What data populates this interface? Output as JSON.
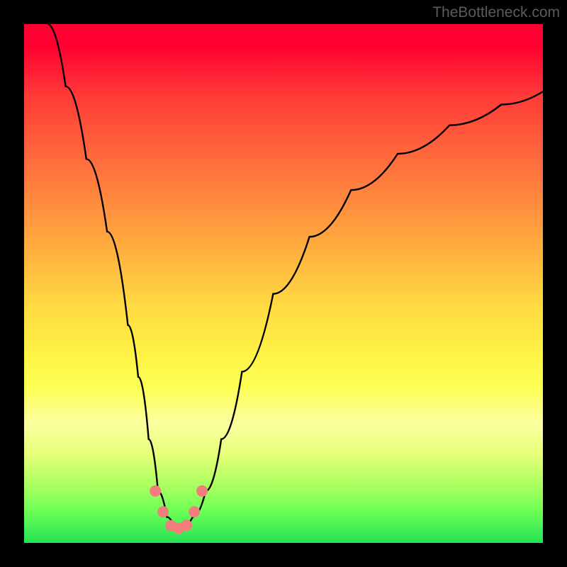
{
  "watermark": "TheBottleneck.com",
  "chart_data": {
    "type": "line",
    "title": "",
    "xlabel": "",
    "ylabel": "",
    "xlim": [
      0,
      100
    ],
    "ylim": [
      0,
      100
    ],
    "series": [
      {
        "name": "bottleneck-curve",
        "x": [
          4.5,
          8,
          12,
          16,
          20,
          22,
          24,
          25.8,
          27.5,
          29,
          30.5,
          32.5,
          35,
          38,
          42,
          48,
          55,
          63,
          72,
          82,
          92,
          100
        ],
        "y": [
          100,
          88,
          74,
          60,
          42,
          32,
          20,
          10,
          5,
          3,
          3,
          5,
          10,
          20,
          33,
          48,
          59,
          68,
          75,
          80.5,
          84.5,
          87
        ]
      }
    ],
    "markers": {
      "name": "highlight-points",
      "color": "#f27d7d",
      "radius": 8,
      "points": [
        {
          "x": 25.3,
          "y": 10.0
        },
        {
          "x": 26.8,
          "y": 6.0
        },
        {
          "x": 28.3,
          "y": 3.3
        },
        {
          "x": 29.8,
          "y": 2.8
        },
        {
          "x": 31.3,
          "y": 3.4
        },
        {
          "x": 32.8,
          "y": 6.0
        },
        {
          "x": 34.3,
          "y": 10.0
        }
      ]
    },
    "gradient_stops": [
      {
        "pos": 0.0,
        "color": "#ff0031"
      },
      {
        "pos": 0.5,
        "color": "#ffd23f"
      },
      {
        "pos": 0.72,
        "color": "#fcff58"
      },
      {
        "pos": 1.0,
        "color": "#25e254"
      }
    ]
  }
}
